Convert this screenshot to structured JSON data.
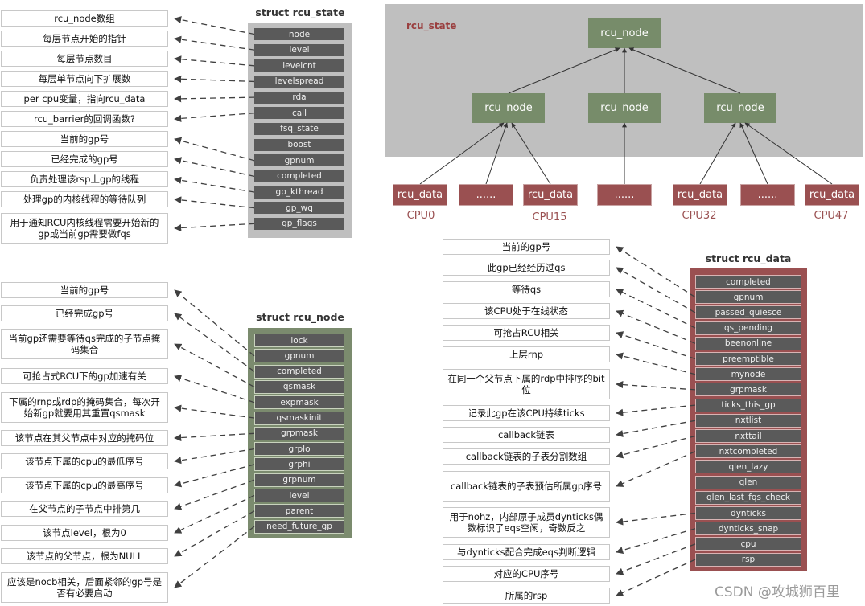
{
  "rcu_state_struct": {
    "title": "struct rcu_state",
    "fields": [
      "node",
      "level",
      "levelcnt",
      "levelspread",
      "rda",
      "call",
      "fsq_state",
      "boost",
      "gpnum",
      "completed",
      "gp_kthread",
      "gp_wq",
      "gp_flags"
    ],
    "notes": [
      {
        "text": "rcu_node数组",
        "field": 0
      },
      {
        "text": "每层节点开始的指针",
        "field": 1
      },
      {
        "text": "每层节点数目",
        "field": 2
      },
      {
        "text": "每层单节点向下扩展数",
        "field": 3
      },
      {
        "text": "per cpu变量，指向rcu_data",
        "field": 4
      },
      {
        "text": "rcu_barrier的回调函数?",
        "field": 5
      },
      {
        "text": "当前的gp号",
        "field": 8
      },
      {
        "text": "已经完成的gp号",
        "field": 9
      },
      {
        "text": "负责处理该rsp上gp的线程",
        "field": 10
      },
      {
        "text": "处理gp的内核线程的等待队列",
        "field": 11
      },
      {
        "text": "用于通知RCU内核线程需要开始新的gp或当前gp需要做fqs",
        "field": 12
      }
    ]
  },
  "rcu_node_struct": {
    "title": "struct rcu_node",
    "fields": [
      "lock",
      "gpnum",
      "completed",
      "qsmask",
      "expmask",
      "qsmaskinit",
      "grpmask",
      "grplo",
      "grphi",
      "grpnum",
      "level",
      "parent",
      "need_future_gp"
    ],
    "notes": [
      {
        "text": "当前的gp号",
        "field": 1
      },
      {
        "text": "已经完成gp号",
        "field": 2
      },
      {
        "text": "当前gp还需要等待qs完成的子节点掩码集合",
        "field": 3
      },
      {
        "text": "可抢占式RCU下的gp加速有关",
        "field": 4
      },
      {
        "text": "下属的rnp或rdp的掩码集合，每次开始新gp就要用其重置qsmask",
        "field": 5
      },
      {
        "text": "该节点在其父节点中对应的掩码位",
        "field": 6
      },
      {
        "text": "该节点下属的cpu的最低序号",
        "field": 7
      },
      {
        "text": "该节点下属的cpu的最高序号",
        "field": 8
      },
      {
        "text": "在父节点的子节点中排第几",
        "field": 9
      },
      {
        "text": "该节点level，根为0",
        "field": 10
      },
      {
        "text": "该节点的父节点，根为NULL",
        "field": 11
      },
      {
        "text": "应该是nocb相关，后面紧邻的gp号是否有必要启动",
        "field": 12
      }
    ]
  },
  "rcu_data_struct": {
    "title": "struct rcu_data",
    "fields": [
      "completed",
      "gpnum",
      "passed_quiesce",
      "qs_pending",
      "beenonline",
      "preemptible",
      "mynode",
      "grpmask",
      "ticks_this_gp",
      "nxtlist",
      "nxttail",
      "nxtcompleted",
      "qlen_lazy",
      "qlen",
      "qlen_last_fqs_check",
      "dynticks",
      "dynticks_snap",
      "cpu",
      "rsp"
    ],
    "notes": [
      {
        "text": "当前的gp号",
        "field": 1
      },
      {
        "text": "此gp已经经历过qs",
        "field": 2
      },
      {
        "text": "等待qs",
        "field": 3
      },
      {
        "text": "该CPU处于在线状态",
        "field": 4
      },
      {
        "text": "可抢占RCU相关",
        "field": 5
      },
      {
        "text": "上层rnp",
        "field": 6
      },
      {
        "text": "在同一个父节点下属的rdp中排序的bit位",
        "field": 7
      },
      {
        "text": "记录此gp在该CPU持续ticks",
        "field": 8
      },
      {
        "text": "callback链表",
        "field": 9
      },
      {
        "text": "callback链表的子表分割数组",
        "field": 10
      },
      {
        "text": "callback链表的子表预估所属gp序号",
        "field": 11
      },
      {
        "text": "用于nohz，内部原子成员dynticks偶数标识了eqs空闲，奇数反之",
        "field": 15
      },
      {
        "text": "与dynticks配合完成eqs判断逻辑",
        "field": 16
      },
      {
        "text": "对应的CPU序号",
        "field": 17
      },
      {
        "text": "所属的rsp",
        "field": 18
      }
    ]
  },
  "tree": {
    "container_label": "rcu_state",
    "root_label": "rcu_node",
    "mid_labels": [
      "rcu_node",
      "rcu_node",
      "rcu_node"
    ],
    "leaf_labels": [
      "rcu_data",
      "......",
      "rcu_data",
      "......",
      "rcu_data",
      "......",
      "rcu_data"
    ],
    "cpu_labels": [
      "CPU0",
      "CPU15",
      "CPU32",
      "CPU47"
    ]
  },
  "watermark": "CSDN @攻城狮百里",
  "colors": {
    "state_panel": "#bfbfbf",
    "node_panel": "#7b8b6e",
    "data_panel": "#9a5051",
    "field": "#5a5a5a",
    "tree_node": "#778c6a",
    "tree_data": "#9a5051",
    "arrow": "#404040"
  }
}
